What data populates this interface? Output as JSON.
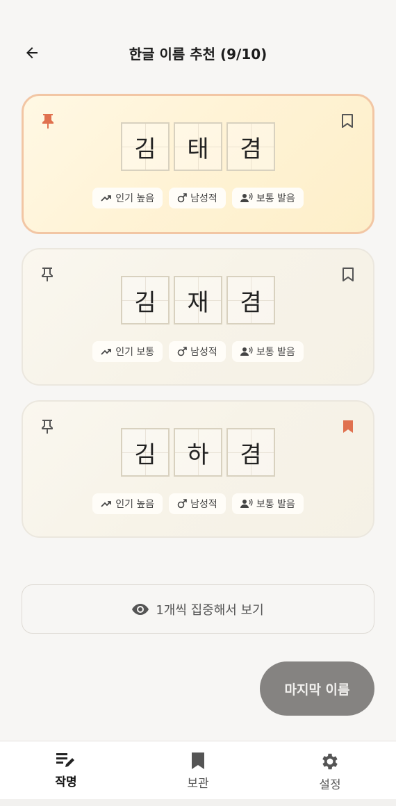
{
  "header": {
    "title": "한글 이름 추천 (9/10)"
  },
  "cards": [
    {
      "syllables": [
        "김",
        "태",
        "겸"
      ],
      "pinned": true,
      "bookmarked": false,
      "tags": [
        "인기 높음",
        "남성적",
        "보통 발음"
      ]
    },
    {
      "syllables": [
        "김",
        "재",
        "겸"
      ],
      "pinned": false,
      "bookmarked": false,
      "tags": [
        "인기 보통",
        "남성적",
        "보통 발음"
      ]
    },
    {
      "syllables": [
        "김",
        "하",
        "겸"
      ],
      "pinned": false,
      "bookmarked": true,
      "tags": [
        "인기 높음",
        "남성적",
        "보통 발음"
      ]
    }
  ],
  "focus_button": {
    "label": "1개씩 집중해서 보기"
  },
  "last_button": {
    "label": "마지막 이름"
  },
  "bottom_nav": [
    {
      "label": "작명",
      "icon": "edit-list-icon",
      "active": true
    },
    {
      "label": "보관",
      "icon": "bookmark-icon",
      "active": false
    },
    {
      "label": "설정",
      "icon": "gear-icon",
      "active": false
    }
  ],
  "colors": {
    "accent": "#e0714f",
    "pin_inactive": "#555555",
    "selected_border": "#f2c6a4",
    "button_gray": "#858381"
  }
}
